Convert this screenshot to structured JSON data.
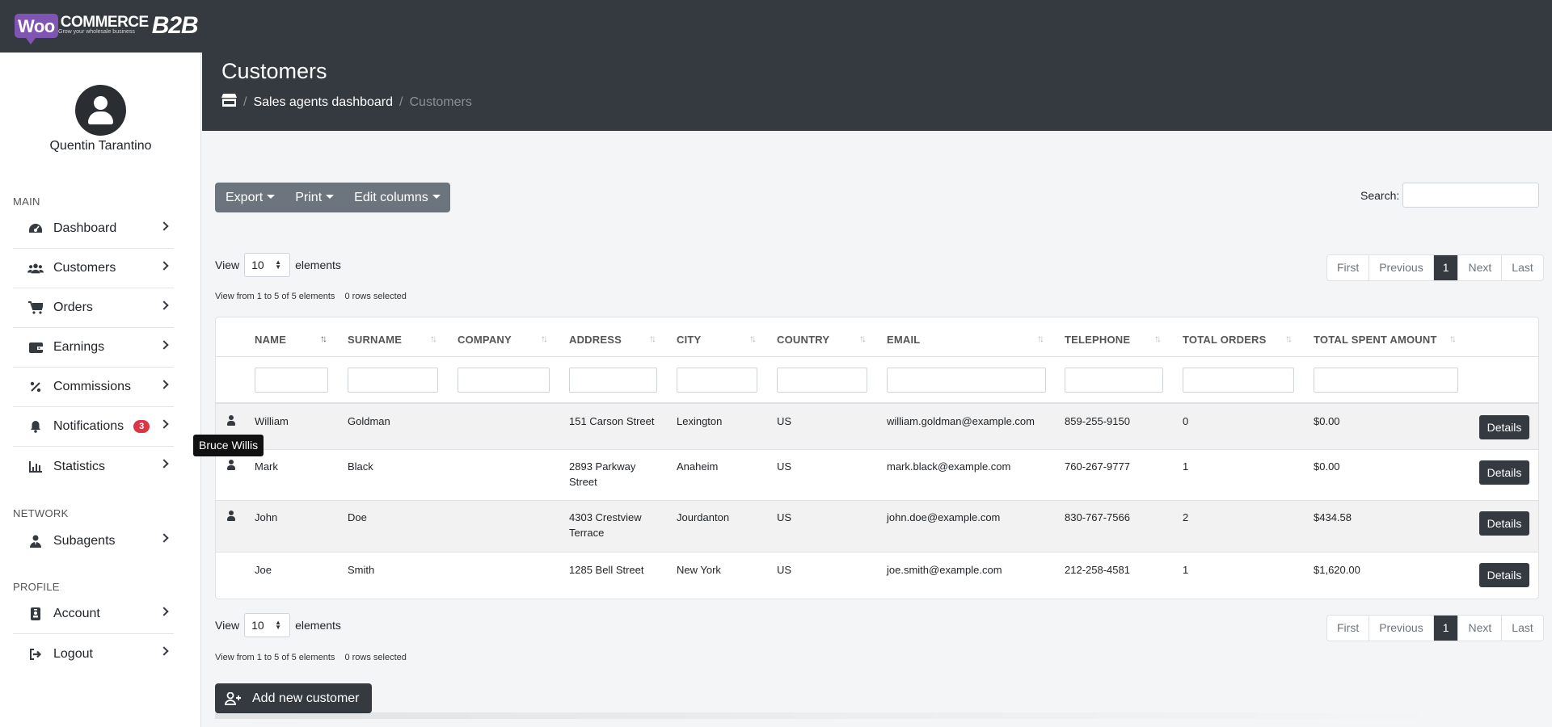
{
  "brand": {
    "woo": "Woo",
    "commerce": "COMMERCE",
    "tagline": "Grow your wholesale business",
    "b2b": "B2B"
  },
  "colors": {
    "header": "#343a40",
    "badge": "#dc3545",
    "woo_purple": "#7f54b3"
  },
  "user": {
    "name": "Quentin Tarantino"
  },
  "sidebar": {
    "sections": {
      "main": "MAIN",
      "network": "NETWORK",
      "profile": "PROFILE"
    },
    "items": [
      {
        "label": "Dashboard",
        "icon": "dashboard-gauge-icon"
      },
      {
        "label": "Customers",
        "icon": "users-icon"
      },
      {
        "label": "Orders",
        "icon": "cart-icon"
      },
      {
        "label": "Earnings",
        "icon": "wallet-icon"
      },
      {
        "label": "Commissions",
        "icon": "percent-icon"
      },
      {
        "label": "Notifications",
        "icon": "bell-icon",
        "badge": "3"
      },
      {
        "label": "Statistics",
        "icon": "bar-chart-icon"
      },
      {
        "label": "Subagents",
        "icon": "user-tie-icon"
      },
      {
        "label": "Account",
        "icon": "id-badge-icon"
      },
      {
        "label": "Logout",
        "icon": "sign-out-icon"
      }
    ]
  },
  "header": {
    "title": "Customers",
    "breadcrumb": {
      "home_icon": "store-icon",
      "link": "Sales agents dashboard",
      "current": "Customers"
    }
  },
  "toolbar": {
    "export": "Export",
    "print": "Print",
    "edit_columns": "Edit columns",
    "search_label": "Search:"
  },
  "view": {
    "prefix": "View",
    "value": "10",
    "suffix": "elements",
    "info": "View from 1 to 5 of 5 elements",
    "selected": "0 rows selected"
  },
  "pagination": {
    "first": "First",
    "previous": "Previous",
    "current": "1",
    "next": "Next",
    "last": "Last"
  },
  "table": {
    "headers": [
      "NAME",
      "SURNAME",
      "COMPANY",
      "ADDRESS",
      "CITY",
      "COUNTRY",
      "EMAIL",
      "TELEPHONE",
      "TOTAL ORDERS",
      "TOTAL SPENT AMOUNT"
    ],
    "rows": [
      {
        "name": "William",
        "surname": "Goldman",
        "company": "",
        "address1": "151 Carson Street",
        "address2": "",
        "city": "Lexington",
        "country": "US",
        "email": "william.goldman@example.com",
        "telephone": "859-255-9150",
        "orders": "0",
        "spent": "$0.00",
        "details": "Details"
      },
      {
        "name": "Mark",
        "surname": "Black",
        "company": "",
        "address1": "2893 Parkway",
        "address2": "Street",
        "city": "Anaheim",
        "country": "US",
        "email": "mark.black@example.com",
        "telephone": "760-267-9777",
        "orders": "1",
        "spent": "$0.00",
        "details": "Details"
      },
      {
        "name": "John",
        "surname": "Doe",
        "company": "",
        "address1": "4303 Crestview",
        "address2": "Terrace",
        "city": "Jourdanton",
        "country": "US",
        "email": "john.doe@example.com",
        "telephone": "830-767-7566",
        "orders": "2",
        "spent": "$434.58",
        "details": "Details"
      },
      {
        "name": "Joe",
        "surname": "Smith",
        "company": "",
        "address1": "1285 Bell Street",
        "address2": "",
        "city": "New York",
        "country": "US",
        "email": "joe.smith@example.com",
        "telephone": "212-258-4581",
        "orders": "1",
        "spent": "$1,620.00",
        "details": "Details"
      }
    ]
  },
  "tooltip": "Bruce Willis",
  "add_customer": "Add new customer"
}
